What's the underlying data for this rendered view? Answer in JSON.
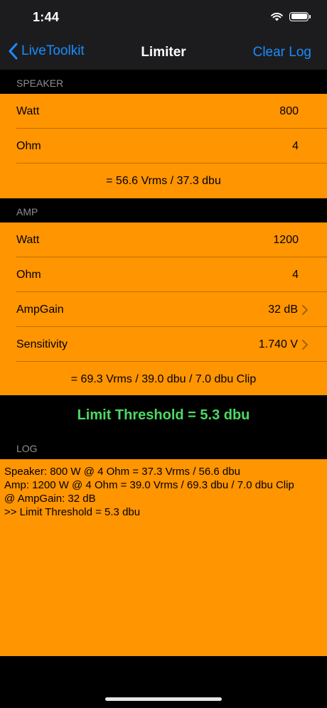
{
  "status": {
    "time": "1:44"
  },
  "nav": {
    "back_label": "LiveToolkit",
    "title": "Limiter",
    "right_label": "Clear Log"
  },
  "speaker": {
    "header": "SPEAKER",
    "rows": [
      {
        "label": "Watt",
        "value": "800"
      },
      {
        "label": "Ohm",
        "value": "4"
      }
    ],
    "result": "= 56.6 Vrms / 37.3 dbu"
  },
  "amp": {
    "header": "AMP",
    "rows": [
      {
        "label": "Watt",
        "value": "1200"
      },
      {
        "label": "Ohm",
        "value": "4"
      },
      {
        "label": "AmpGain",
        "value": "32 dB"
      },
      {
        "label": "Sensitivity",
        "value": "1.740 V"
      }
    ],
    "result": "= 69.3 Vrms / 39.0 dbu / 7.0 dbu Clip"
  },
  "limit_threshold": "Limit Threshold = 5.3 dbu",
  "log": {
    "header": "LOG",
    "text": "Speaker: 800 W @ 4 Ohm = 37.3 Vrms / 56.6 dbu\nAmp: 1200 W @ 4 Ohm = 39.0 Vrms / 69.3 dbu / 7.0 dbu Clip\n@ AmpGain: 32 dB\n>> Limit Threshold = 5.3 dbu"
  },
  "colors": {
    "accent": "#ff9500",
    "link": "#1a8cff",
    "threshold": "#4cd964"
  }
}
